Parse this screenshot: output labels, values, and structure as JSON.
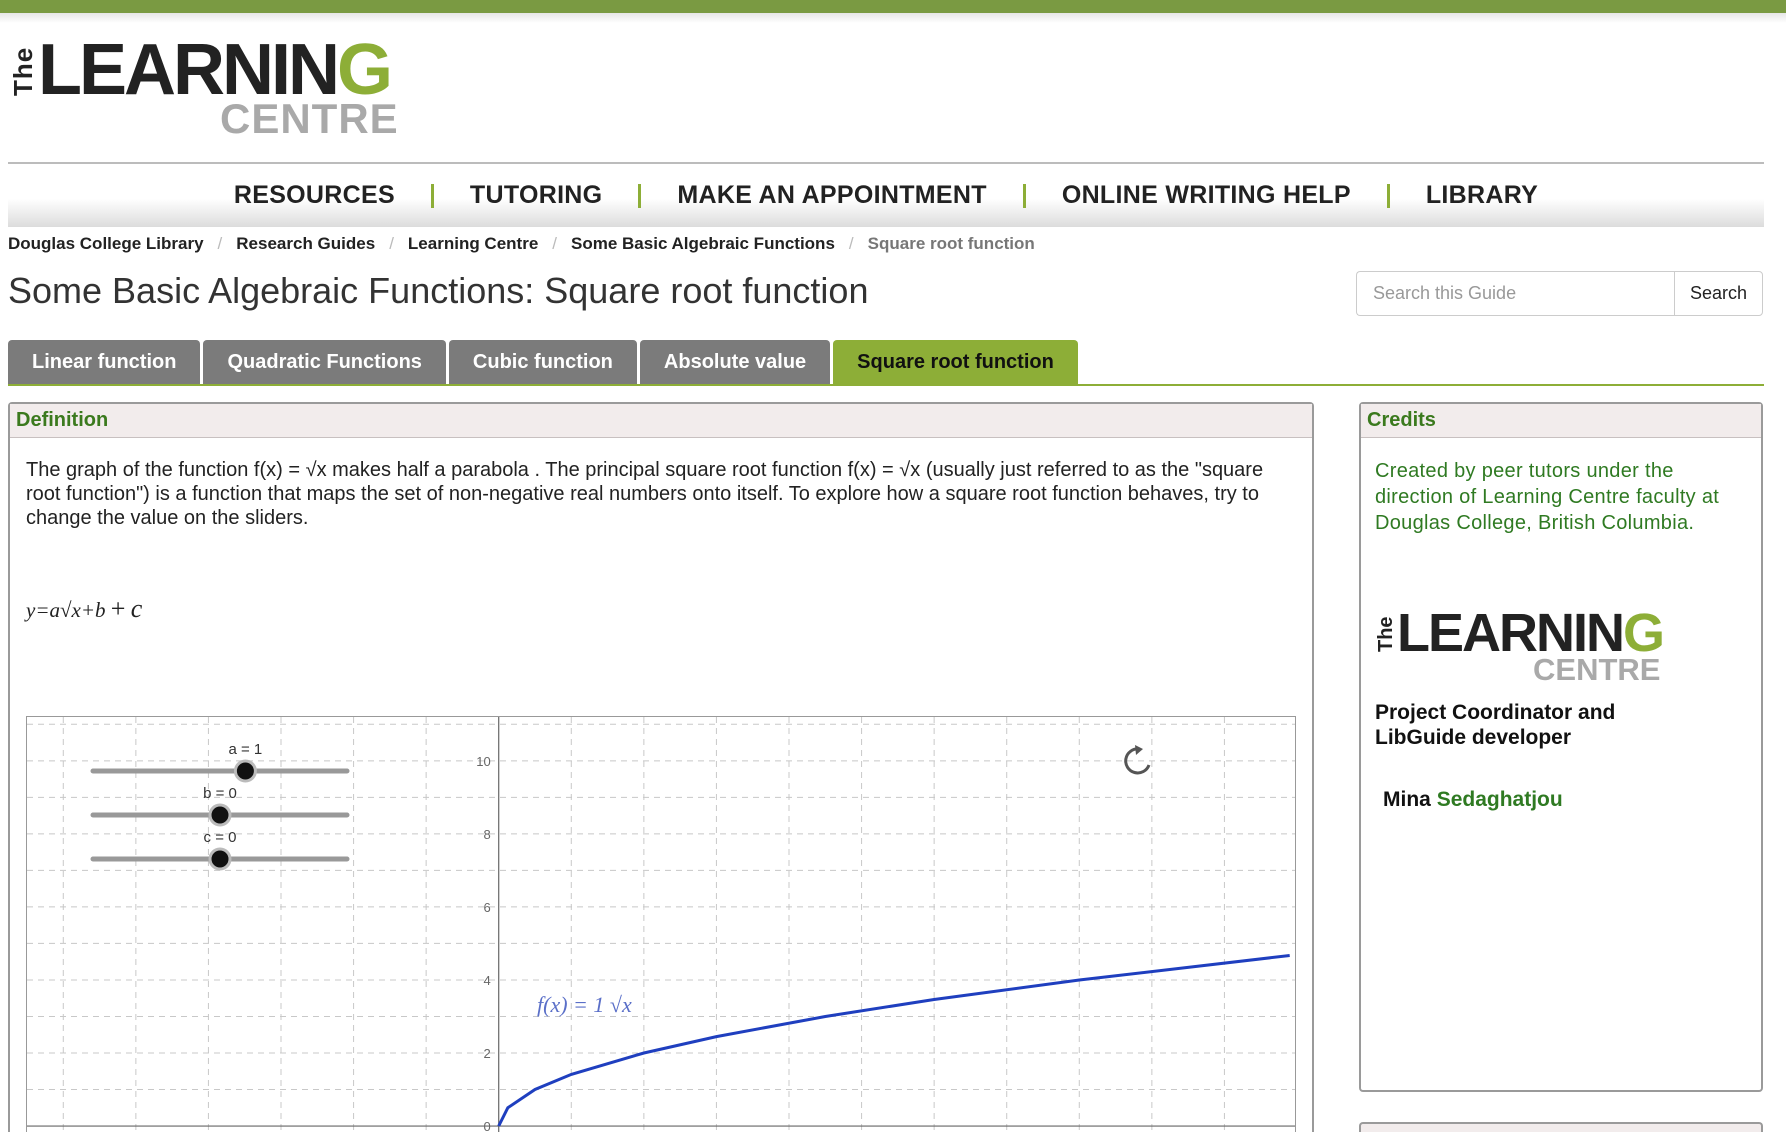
{
  "brand": {
    "the": "The",
    "learning": "LEARNIN",
    "learning_g": "G",
    "centre": "CENTRE"
  },
  "nav": {
    "items": [
      "RESOURCES",
      "TUTORING",
      "MAKE AN APPOINTMENT",
      "ONLINE WRITING HELP",
      "LIBRARY"
    ]
  },
  "breadcrumb": [
    "Douglas College Library",
    "Research Guides",
    "Learning Centre",
    "Some Basic Algebraic Functions",
    "Square root function"
  ],
  "page_title": "Some Basic Algebraic Functions: Square root function",
  "search": {
    "placeholder": "Search this Guide",
    "button": "Search"
  },
  "tabs": [
    {
      "label": "Linear function",
      "active": false
    },
    {
      "label": "Quadratic Functions",
      "active": false
    },
    {
      "label": "Cubic function",
      "active": false
    },
    {
      "label": "Absolute value",
      "active": false
    },
    {
      "label": "Square root function",
      "active": true
    }
  ],
  "definition": {
    "heading": "Definition",
    "text": "The graph of the function f(x) = √x makes half a parabola . The principal square root function f(x) = √x (usually just referred to as the \"square root function\") is a function that maps the set of non-negative real numbers onto itself. To explore how a square root function behaves, try to change the value on the sliders.",
    "formula": "y=a√x+b",
    "formula_plus": "+",
    "formula_c": "c"
  },
  "applet": {
    "sliders": [
      {
        "label": "a = 1",
        "name": "a",
        "value": 1,
        "min": -5,
        "max": 5
      },
      {
        "label": "b = 0",
        "name": "b",
        "value": 0,
        "min": -5,
        "max": 5
      },
      {
        "label": "c = 0",
        "name": "c",
        "value": 0,
        "min": -5,
        "max": 5
      }
    ],
    "function_label": "f(x) = 1 √x",
    "reset_icon": "refresh-icon",
    "curve_color": "#1f3fbf"
  },
  "chart_data": {
    "type": "line",
    "title": "",
    "xlabel": "",
    "ylabel": "",
    "xlim": [
      -13,
      22
    ],
    "ylim": [
      -0.3,
      11.2
    ],
    "y_ticks": [
      0,
      2,
      4,
      6,
      8,
      10
    ],
    "grid": true,
    "series": [
      {
        "name": "f(x) = 1 √x",
        "x": [
          0,
          0.25,
          1,
          2,
          4,
          6,
          9,
          12,
          16,
          21.8
        ],
        "y": [
          0,
          0.5,
          1,
          1.414,
          2,
          2.449,
          3,
          3.464,
          4,
          4.669
        ]
      }
    ]
  },
  "credits": {
    "heading": "Credits",
    "text": "Created by peer tutors under the direction of Learning Centre faculty at Douglas College, British Columbia.",
    "role": "Project Coordinator and LibGuide developer",
    "first_name": "Mina",
    "last_name": "Sedaghatjou"
  },
  "colors": {
    "accent_green": "#8dae37",
    "tab_gray": "#7b7b7b",
    "heading_green": "#3b7a1e"
  }
}
